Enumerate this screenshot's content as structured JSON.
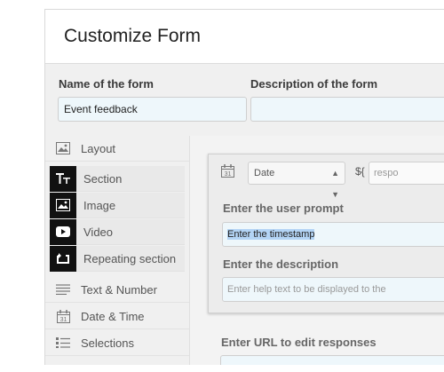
{
  "header": {
    "title": "Customize Form"
  },
  "form": {
    "name_label": "Name of the form",
    "name_value": "Event feedback",
    "description_label": "Description of the form",
    "description_value": ""
  },
  "sidebar": {
    "items": [
      {
        "label": "Layout",
        "icon": "image-icon"
      },
      {
        "label": "Section",
        "icon": "text-size-icon"
      },
      {
        "label": "Image",
        "icon": "image-icon"
      },
      {
        "label": "Video",
        "icon": "play-icon"
      },
      {
        "label": "Repeating section",
        "icon": "repeat-icon"
      },
      {
        "label": "Text & Number",
        "icon": "lines-icon"
      },
      {
        "label": "Date & Time",
        "icon": "calendar-icon"
      },
      {
        "label": "Selections",
        "icon": "list-icon"
      }
    ]
  },
  "field_card": {
    "type_select": "Date",
    "var_prefix": "${",
    "var_placeholder": "respo",
    "prompt_label": "Enter the user prompt",
    "prompt_value": "Enter the timestamp",
    "description_label": "Enter the description",
    "description_placeholder": "Enter help text to be displayed to the"
  },
  "edit_url": {
    "label": "Enter URL to edit responses"
  },
  "colors": {
    "selection": "#b3d4f5",
    "input_bg": "#eef7fb"
  }
}
